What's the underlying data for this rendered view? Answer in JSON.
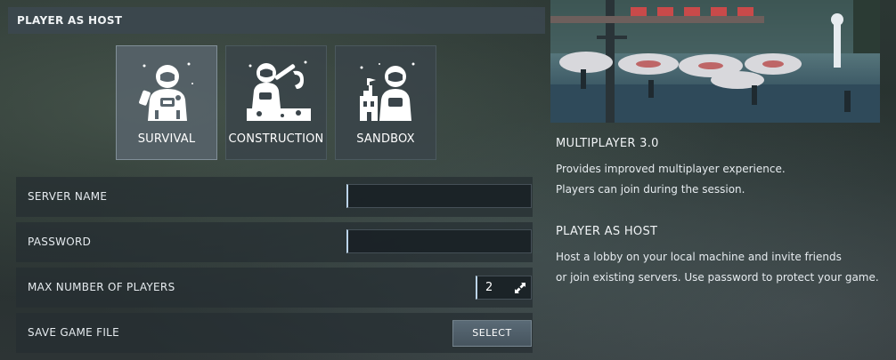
{
  "header": {
    "title": "PLAYER AS HOST"
  },
  "modes": [
    {
      "label": "SURVIVAL",
      "selected": true
    },
    {
      "label": "CONSTRUCTION",
      "selected": false
    },
    {
      "label": "SANDBOX",
      "selected": false
    }
  ],
  "form": {
    "server_name": {
      "label": "SERVER NAME",
      "value": ""
    },
    "password": {
      "label": "PASSWORD",
      "value": ""
    },
    "max_players": {
      "label": "MAX NUMBER OF PLAYERS",
      "value": "2"
    },
    "save_file": {
      "label": "SAVE GAME FILE",
      "button_label": "SELECT"
    }
  },
  "info": {
    "section1": {
      "title": "MULTIPLAYER 3.0",
      "line1": "Provides improved multiplayer experience.",
      "line2": "Players can join during the session."
    },
    "section2": {
      "title": "PLAYER AS HOST",
      "line1": "Host a lobby on your local machine and invite friends",
      "line2": "or join existing servers. Use password to protect your game."
    }
  },
  "icons": {
    "survival": "astronaut-survival-icon",
    "construction": "astronaut-construction-icon",
    "sandbox": "astronaut-sandbox-icon",
    "stepper": "expand-arrows-icon"
  },
  "colors": {
    "header_bg": "#3c4850",
    "selected_card_bg": "#58646c",
    "input_accent": "#bcd4ea",
    "button_bg": "#50606b"
  }
}
